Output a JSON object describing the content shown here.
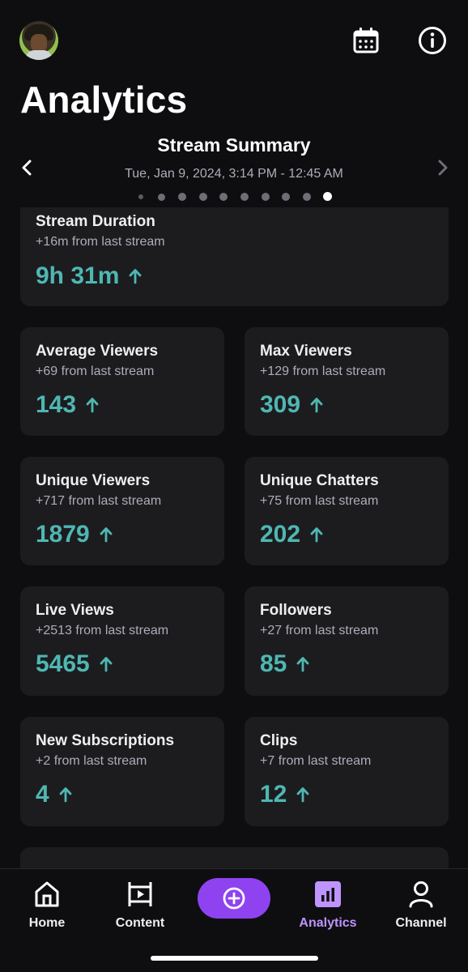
{
  "header": {
    "title": "Analytics",
    "avatar_icon": "user-avatar",
    "calendar_icon": "calendar-icon",
    "info_icon": "info-icon"
  },
  "summary": {
    "title": "Stream Summary",
    "date_range": "Tue, Jan 9, 2024, 3:14 PM - 12:45 AM",
    "page_count": 10,
    "active_page": 10
  },
  "stats": [
    {
      "label": "Stream Duration",
      "change": "+16m from last stream",
      "value": "9h 31m",
      "trend": "up"
    },
    {
      "label": "Average Viewers",
      "change": "+69 from last stream",
      "value": "143",
      "trend": "up"
    },
    {
      "label": "Max Viewers",
      "change": "+129 from last stream",
      "value": "309",
      "trend": "up"
    },
    {
      "label": "Unique Viewers",
      "change": "+717 from last stream",
      "value": "1879",
      "trend": "up"
    },
    {
      "label": "Unique Chatters",
      "change": "+75 from last stream",
      "value": "202",
      "trend": "up"
    },
    {
      "label": "Live Views",
      "change": "+2513 from last stream",
      "value": "5465",
      "trend": "up"
    },
    {
      "label": "Followers",
      "change": "+27 from last stream",
      "value": "85",
      "trend": "up"
    },
    {
      "label": "New Subscriptions",
      "change": "+2 from last stream",
      "value": "4",
      "trend": "up"
    },
    {
      "label": "Clips",
      "change": "+7 from last stream",
      "value": "12",
      "trend": "up"
    }
  ],
  "nav": {
    "items": [
      {
        "label": "Home",
        "icon": "home-icon"
      },
      {
        "label": "Content",
        "icon": "film-icon"
      },
      {
        "label": "Analytics",
        "icon": "bar-chart-icon",
        "active": true
      },
      {
        "label": "Channel",
        "icon": "person-icon"
      }
    ],
    "create_icon": "plus-circle-icon"
  },
  "colors": {
    "background": "#0e0e10",
    "card": "#1c1c1f",
    "accent_value": "#4fb7b2",
    "accent_purple": "#8f43f0",
    "active_nav": "#bf94ff"
  }
}
